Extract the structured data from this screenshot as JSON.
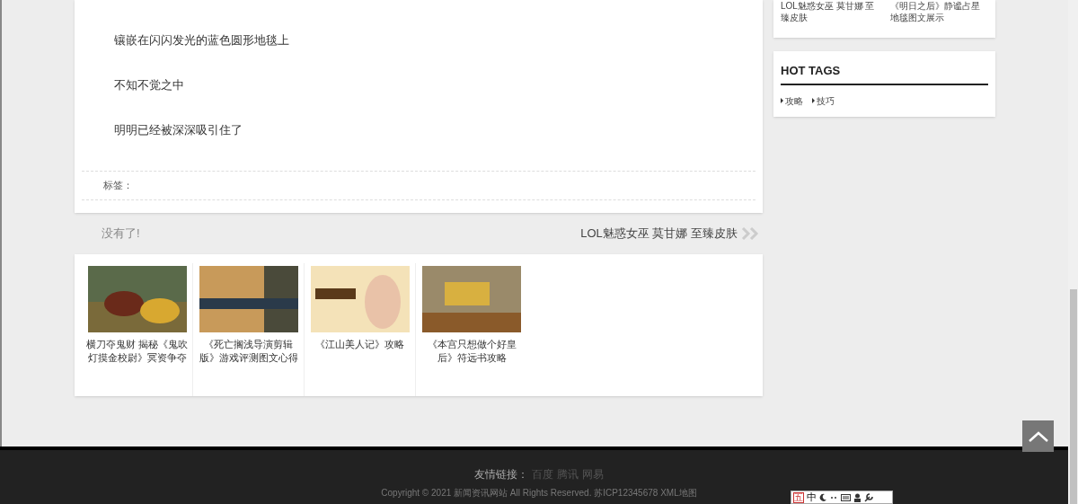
{
  "article": {
    "paragraphs": [
      "镶嵌在闪闪发光的蓝色圆形地毯上",
      "不知不觉之中",
      "明明已经被深深吸引住了"
    ],
    "tags_label": "标签："
  },
  "post_nav": {
    "previous": "没有了!",
    "next": "LOL魅惑女巫 莫甘娜 至臻皮肤"
  },
  "related": [
    {
      "title": "横刀夺鬼财 揭秘《鬼吹灯摸金校尉》冥资争夺",
      "kind": "battle"
    },
    {
      "title": "《死亡搁浅导演剪辑版》游戏评测图文心得",
      "kind": "death"
    },
    {
      "title": "《江山美人记》攻略",
      "kind": "beauty"
    },
    {
      "title": "《本宫只想做个好皇后》符远书攻略",
      "kind": "palace"
    }
  ],
  "sidebar": {
    "recent": [
      "LOL魅惑女巫 莫甘娜 至臻皮肤",
      "《明日之后》静谧占星地毯图文展示"
    ],
    "hot_tags": {
      "title": "HOT TAGS",
      "tags": [
        "攻略",
        "技巧"
      ]
    }
  },
  "footer": {
    "links_label": "友情链接：",
    "links": [
      "百度",
      "腾讯",
      "网易"
    ],
    "copyright": "Copyright © 2021 新闻资讯网站 All Rights Reserved. 苏ICP12345678 XML地图"
  },
  "ime_bar": {
    "mode": "五",
    "language": "中"
  }
}
